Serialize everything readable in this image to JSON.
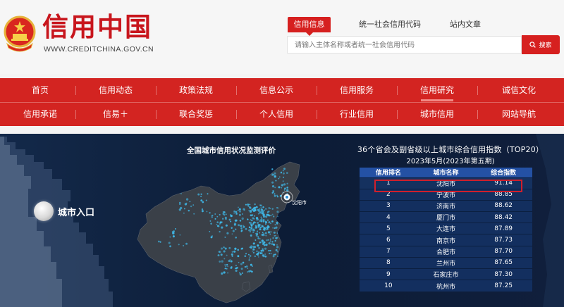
{
  "header": {
    "logo_text": "信用中国",
    "logo_url": "WWW.CREDITCHINA.GOV.CN",
    "search_tabs": [
      "信用信息",
      "统一社会信用代码",
      "站内文章"
    ],
    "active_search_tab": 0,
    "search_placeholder": "请输入主体名称或者统一社会信用代码",
    "search_button": "搜索"
  },
  "nav": {
    "row1": [
      "首页",
      "信用动态",
      "政策法规",
      "信息公示",
      "信用服务",
      "信用研究",
      "诚信文化"
    ],
    "row2": [
      "信用承诺",
      "信易＋",
      "联合奖惩",
      "个人信用",
      "行业信用",
      "城市信用",
      "网站导航"
    ],
    "current_item": "信用研究"
  },
  "dashboard": {
    "city_entry": "城市入口",
    "map_title": "全国城市信用状况监测评价",
    "map_marker": "沈阳市",
    "ranking": {
      "title": "36个省会及副省级以上城市综合信用指数（TOP20）",
      "subtitle": "2023年5月(2023年第五期)",
      "columns": [
        "信用排名",
        "城市名称",
        "综合指数"
      ],
      "rows": [
        [
          "1",
          "沈阳市",
          "91.14"
        ],
        [
          "2",
          "宁波市",
          "88.85"
        ],
        [
          "3",
          "济南市",
          "88.62"
        ],
        [
          "4",
          "厦门市",
          "88.42"
        ],
        [
          "5",
          "大连市",
          "87.89"
        ],
        [
          "6",
          "南京市",
          "87.73"
        ],
        [
          "7",
          "合肥市",
          "87.70"
        ],
        [
          "8",
          "兰州市",
          "87.65"
        ],
        [
          "9",
          "石家庄市",
          "87.30"
        ],
        [
          "10",
          "杭州市",
          "87.25"
        ]
      ]
    }
  },
  "colors": {
    "brand_red": "#d32421",
    "dashboard_bg": "#0e1f3a",
    "table_header": "#2451a4",
    "map_dots": "#3fb8e8"
  }
}
